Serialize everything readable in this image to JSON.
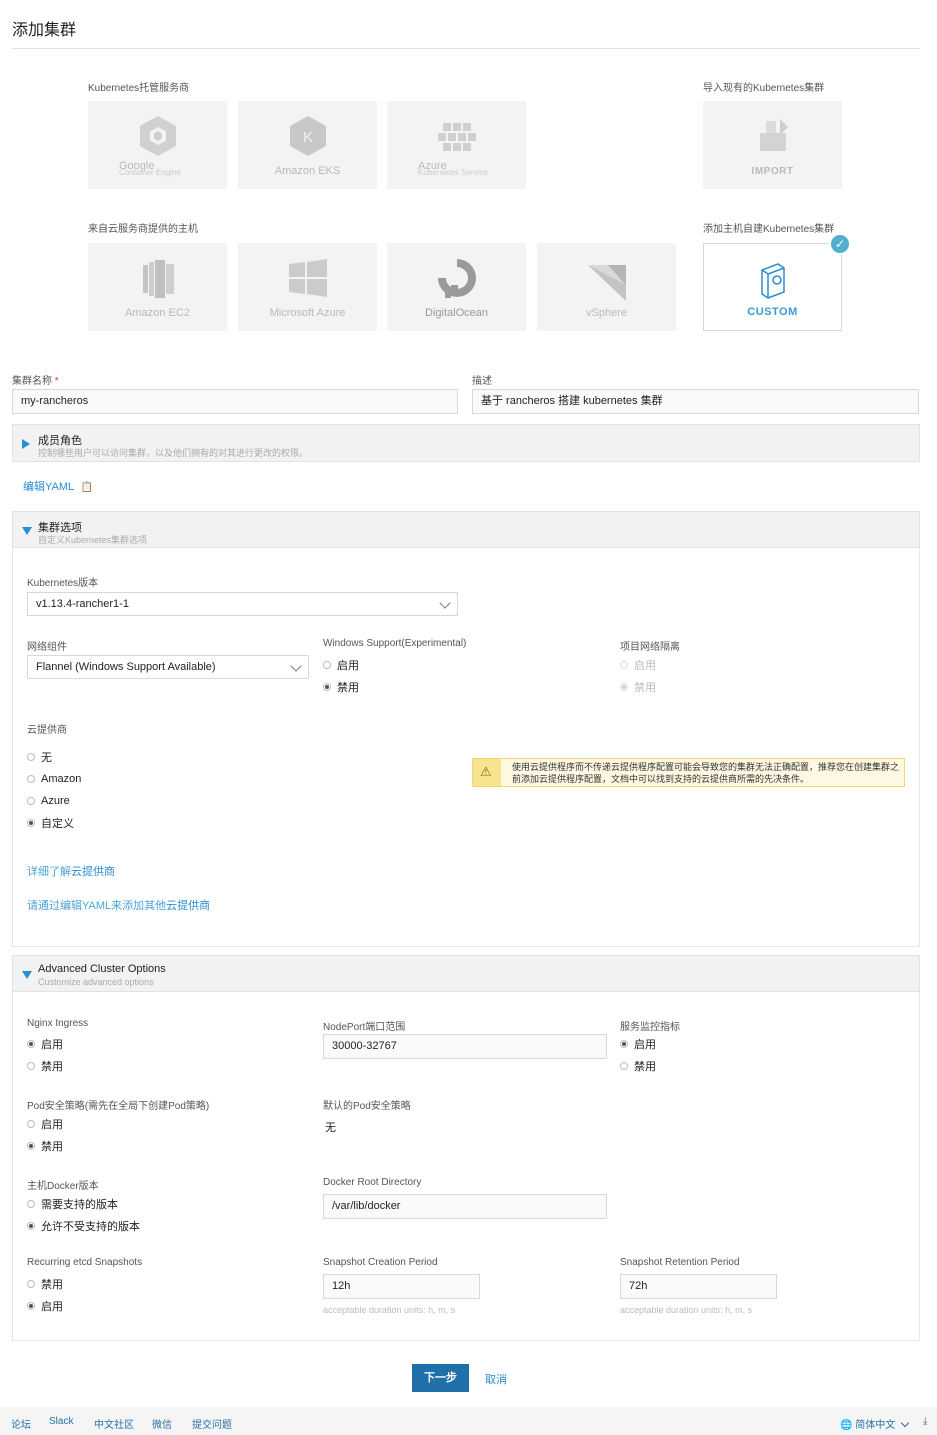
{
  "page": {
    "title": "添加集群"
  },
  "hosted": {
    "label": "Kubernetes托管服务商",
    "tiles": [
      {
        "label": "Google",
        "sub": "Container Engine"
      },
      {
        "label": "Amazon EKS"
      },
      {
        "label": "Azure",
        "sub": "Kubernetes Service"
      }
    ]
  },
  "import": {
    "label": "导入现有的Kubernetes集群",
    "tile": "IMPORT"
  },
  "cloud_hosts": {
    "label": "来自云服务商提供的主机",
    "tiles": [
      {
        "label": "Amazon EC2"
      },
      {
        "label": "Microsoft Azure"
      },
      {
        "label": "DigitalOcean"
      },
      {
        "label": "vSphere"
      }
    ]
  },
  "custom": {
    "label": "添加主机自建Kubernetes集群",
    "tile": "CUSTOM",
    "check": "✓"
  },
  "form": {
    "name_label": "集群名称",
    "required_mark": "*",
    "name_value": "my-rancheros",
    "desc_label": "描述",
    "desc_value": "基于 rancheros 搭建 kubernetes 集群"
  },
  "members": {
    "title": "成员角色",
    "desc": "控制哪些用户可以访问集群，以及他们拥有的对其进行更改的权限。"
  },
  "edit_yaml": {
    "label": "编辑YAML",
    "icon": "📋"
  },
  "cluster_options": {
    "title": "集群选项",
    "desc": "自定义Kubernetes集群选项",
    "k8s_label": "Kubernetes版本",
    "k8s_value": "v1.13.4-rancher1-1",
    "network_label": "网络组件",
    "network_value": "Flannel (Windows Support Available)",
    "windows_label": "Windows Support(Experimental)",
    "windows_opts": [
      "启用",
      "禁用"
    ],
    "isolation_label": "项目网络隔离",
    "isolation_opts": [
      "启用",
      "禁用"
    ],
    "cloud_label": "云提供商",
    "cloud_opts": [
      "无",
      "Amazon",
      "Azure",
      "自定义"
    ],
    "warning": "使用云提供程序而不传递云提供程序配置可能会导致您的集群无法正确配置，推荐您在创建集群之前添加云提供程序配置，文档中可以找到支持的云提供商所需的先决条件。",
    "warning_icon": "⚠",
    "link1_pre": "详细了解",
    "link1": "云提供商",
    "link2_pre": "请通过编辑YAML来添加其他",
    "link2": "云提供商"
  },
  "advanced": {
    "title": "Advanced Cluster Options",
    "desc": "Customize advanced options",
    "nginx_label": "Nginx Ingress",
    "nginx_opts": [
      "启用",
      "禁用"
    ],
    "nodeport_label": "NodePort端口范围",
    "nodeport_value": "30000-32767",
    "monitor_label": "服务监控指标",
    "monitor_opts": [
      "启用",
      "禁用"
    ],
    "psp_label": "Pod安全策略(需先在全局下创建Pod策略)",
    "psp_opts": [
      "启用",
      "禁用"
    ],
    "default_psp_label": "默认的Pod安全策略",
    "default_psp_value": "无",
    "docker_label": "主机Docker版本",
    "docker_opts": [
      "需要支持的版本",
      "允许不受支持的版本"
    ],
    "docker_root_label": "Docker Root Directory",
    "docker_root_value": "/var/lib/docker",
    "etcd_label": "Recurring etcd Snapshots",
    "etcd_opts": [
      "禁用",
      "启用"
    ],
    "creation_label": "Snapshot Creation Period",
    "creation_value": "12h",
    "retention_label": "Snapshot Retention Period",
    "retention_value": "72h",
    "hint": "acceptable duration units: h, m, s"
  },
  "actions": {
    "next": "下一步",
    "cancel": "取消"
  },
  "footer": {
    "links": [
      "论坛",
      "Slack",
      "中文社区",
      "微信",
      "提交问题"
    ],
    "language": "简体中文",
    "globe_icon": "🌐",
    "download_icon": "⤓"
  }
}
